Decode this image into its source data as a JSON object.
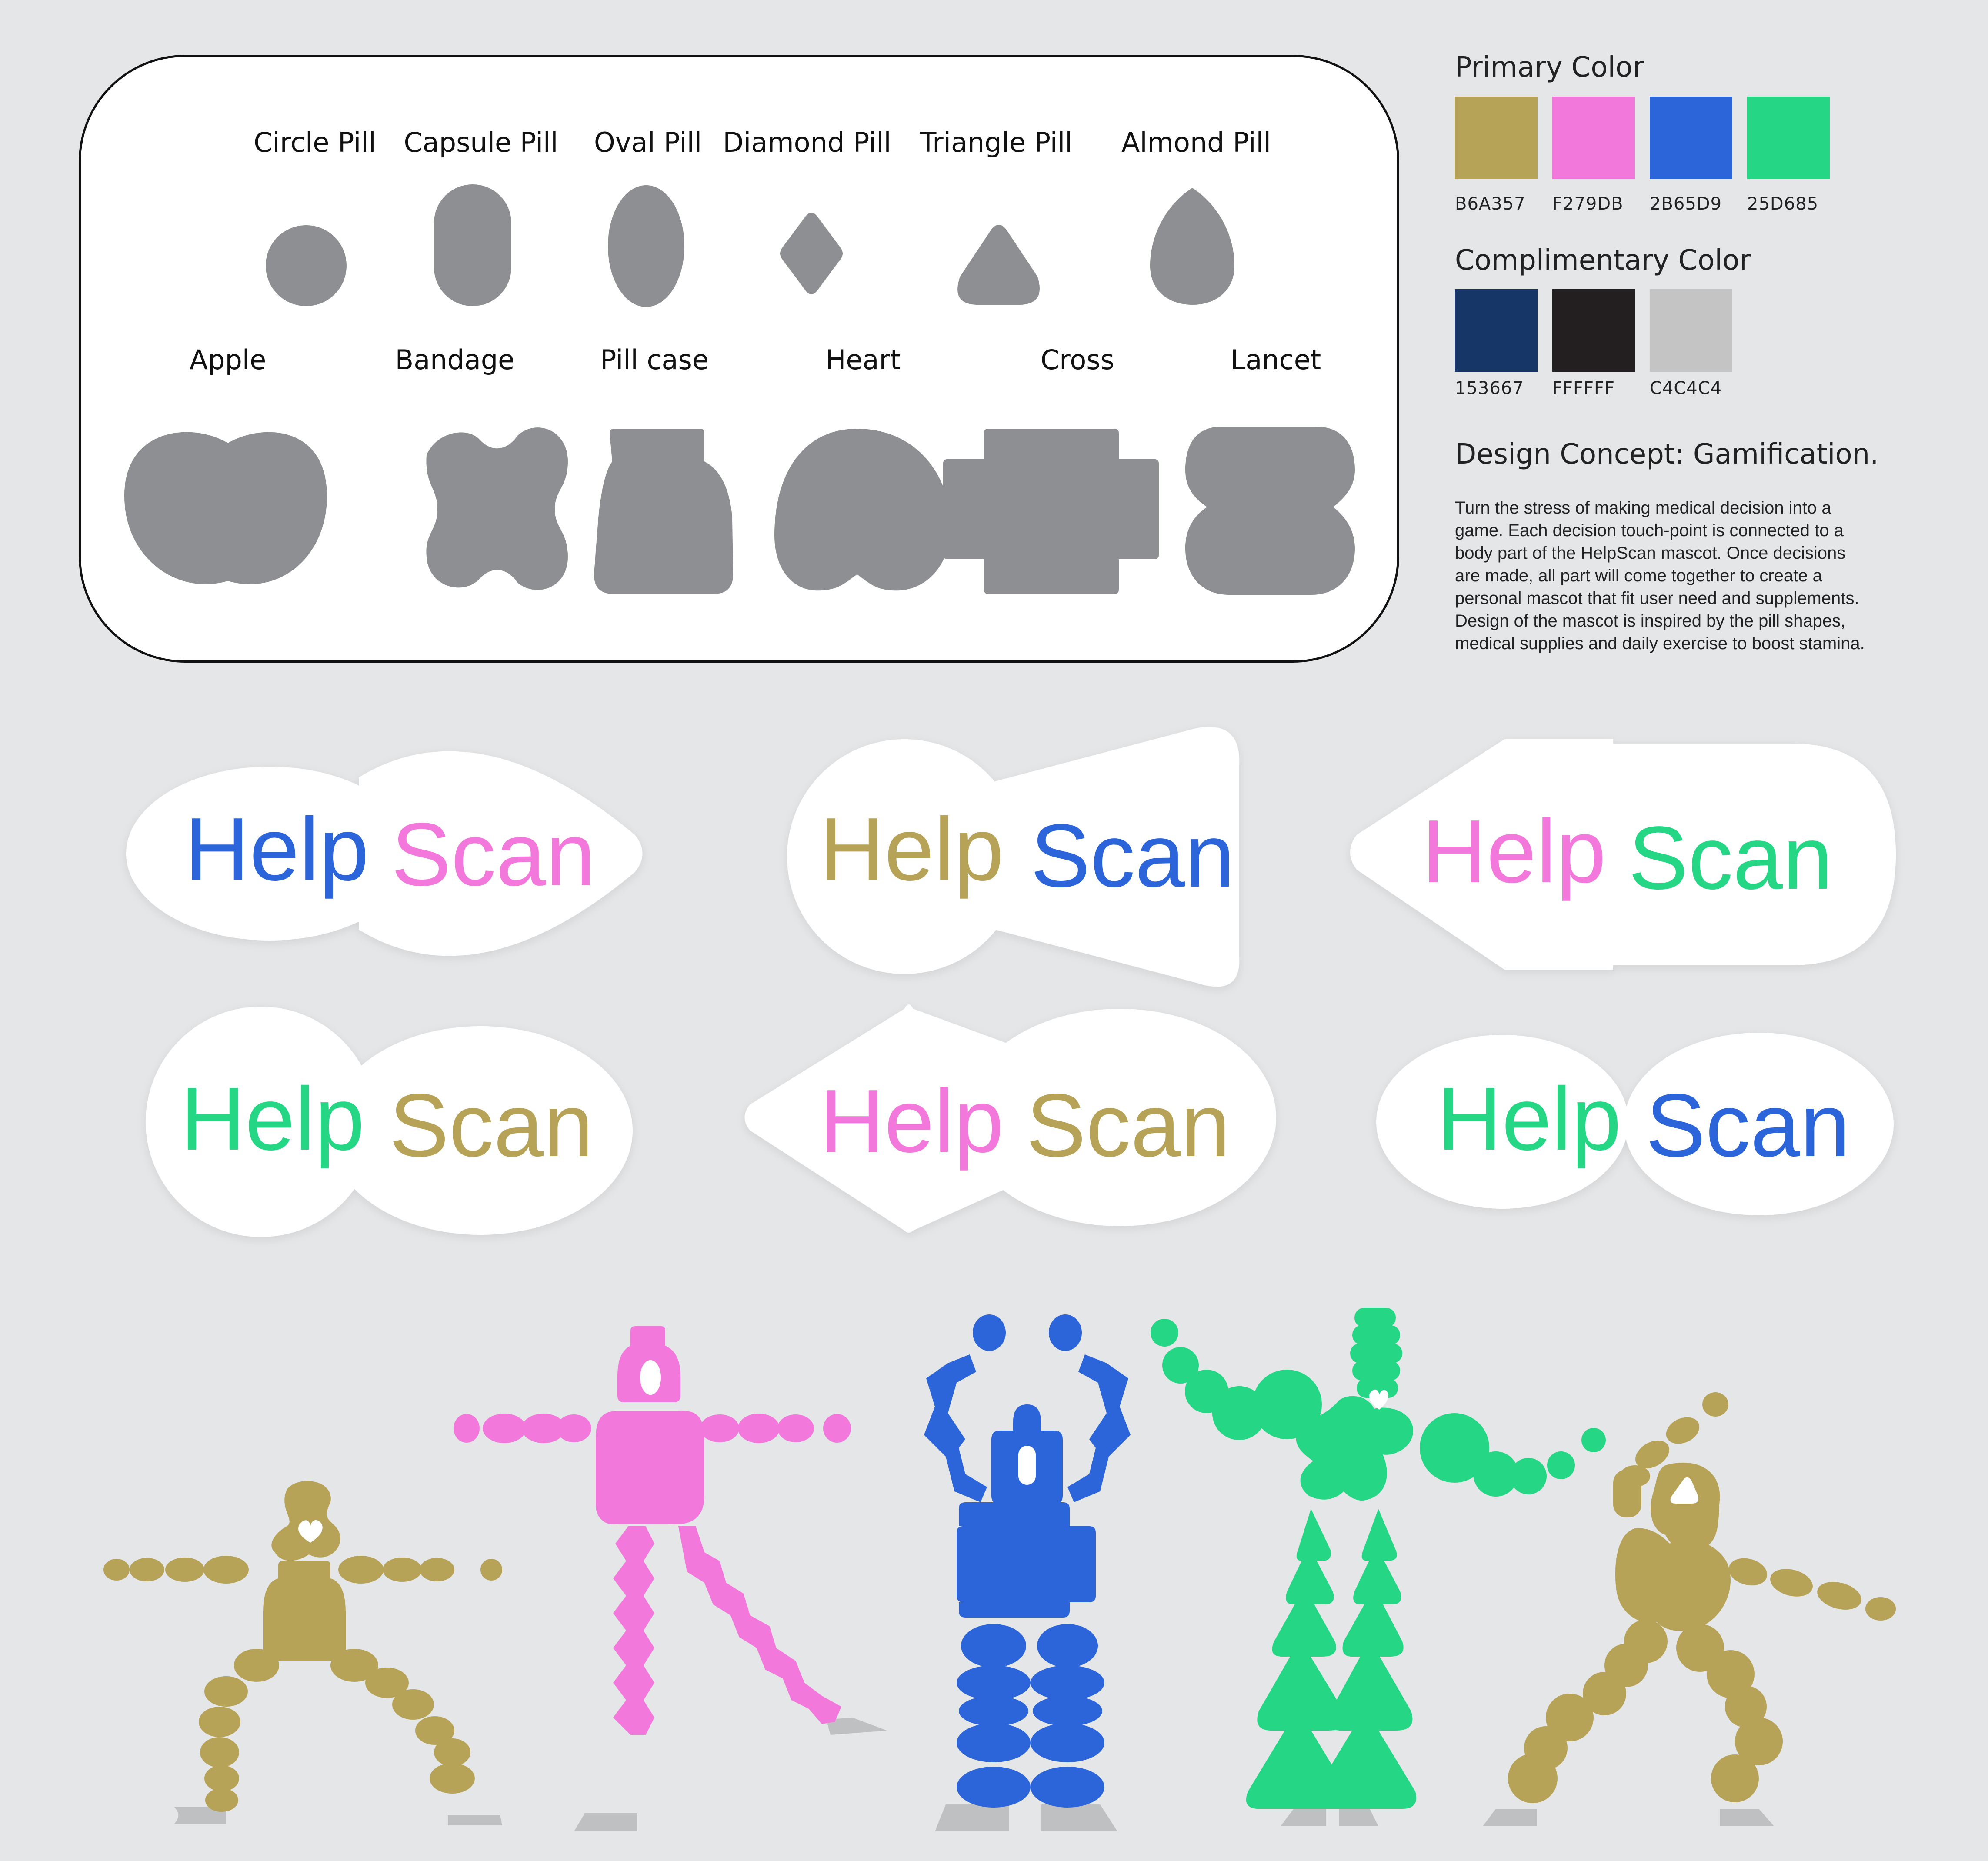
{
  "pill_shapes": {
    "row1": [
      "Circle Pill",
      "Capsule Pill",
      "Oval Pill",
      "Diamond Pill",
      "Triangle Pill",
      "Almond Pill"
    ],
    "row2": [
      "Apple",
      "Bandage",
      "Pill case",
      "Heart",
      "Cross",
      "Lancet"
    ]
  },
  "primary": {
    "title": "Primary Color",
    "swatches": [
      {
        "color": "#B6A357",
        "label": "B6A357"
      },
      {
        "color": "#F279DB",
        "label": "F279DB"
      },
      {
        "color": "#2B65D9",
        "label": "2B65D9"
      },
      {
        "color": "#25D685",
        "label": "25D685"
      }
    ]
  },
  "complimentary": {
    "title": "Complimentary Color",
    "swatches": [
      {
        "color": "#153667",
        "label": "153667"
      },
      {
        "color": "#231F20",
        "label": "FFFFFF"
      },
      {
        "color": "#C4C4C4",
        "label": "C4C4C4"
      }
    ]
  },
  "concept": {
    "title": "Design Concept: Gamification.",
    "lines": [
      "Turn the stress of making medical decision into a",
      "game. Each decision touch-point is connected to a",
      "body part of the HelpScan mascot. Once decisions",
      "are made, all part will come together to create a",
      "personal mascot that fit user need and supplements.",
      "Design of the mascot is inspired by the pill shapes,",
      "medical supplies and daily exercise to boost stamina."
    ]
  },
  "logos": [
    {
      "help": "Help",
      "scan": "Scan",
      "help_color": "#2B65D9",
      "scan_color": "#F279DB"
    },
    {
      "help": "Help",
      "scan": "Scan",
      "help_color": "#B6A357",
      "scan_color": "#2B65D9"
    },
    {
      "help": "Help",
      "scan": "Scan",
      "help_color": "#F279DB",
      "scan_color": "#25D685"
    },
    {
      "help": "Help",
      "scan": "Scan",
      "help_color": "#25D685",
      "scan_color": "#B6A357"
    },
    {
      "help": "Help",
      "scan": "Scan",
      "help_color": "#F279DB",
      "scan_color": "#B6A357"
    },
    {
      "help": "Help",
      "scan": "Scan",
      "help_color": "#25D685",
      "scan_color": "#2B65D9"
    }
  ],
  "colors": {
    "shape_gray": "#8E8F93",
    "background": "#E5E6E8",
    "shadow_gray": "#BFC0C2"
  }
}
